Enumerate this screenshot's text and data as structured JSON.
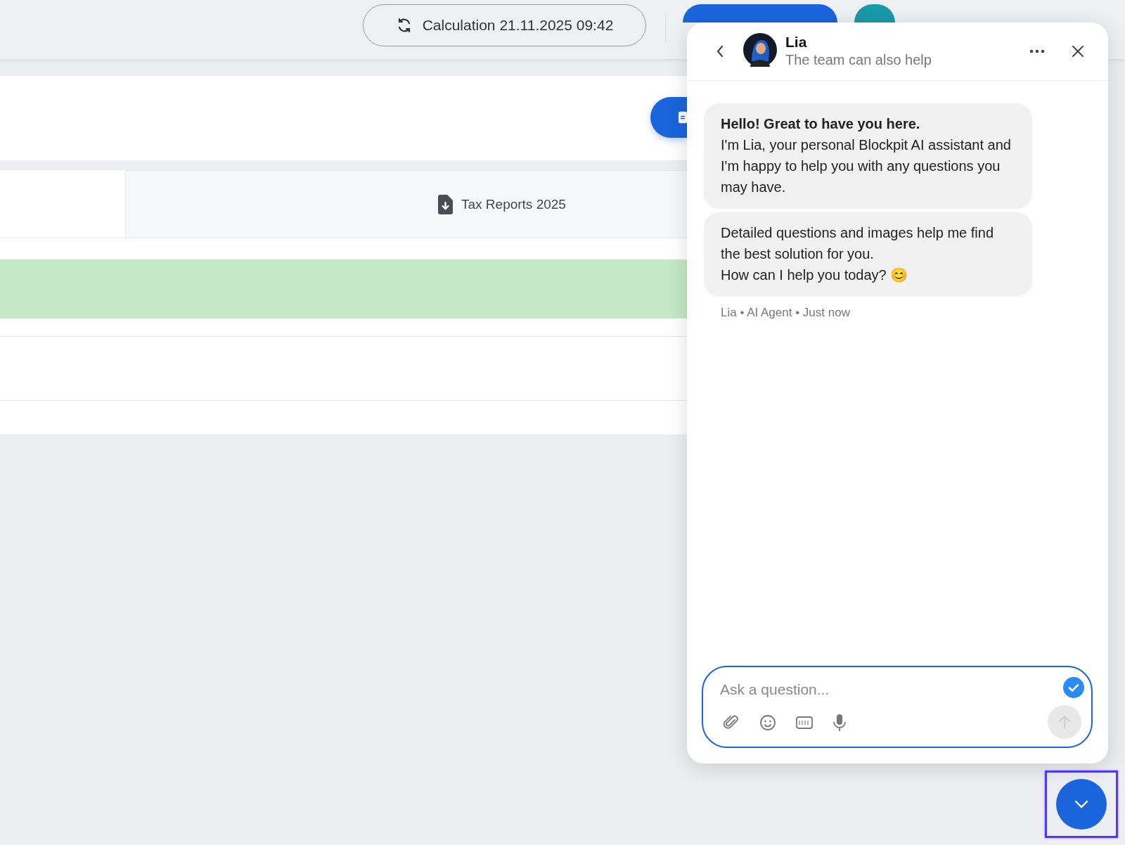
{
  "top_bar": {
    "calculation_button": "Calculation 21.11.2025 09:42"
  },
  "report_tab": {
    "label": "Tax Reports 2025"
  },
  "chat": {
    "agent_name": "Lia",
    "agent_subtitle": "The team can also help",
    "messages": [
      {
        "text": "**Hello! Great to have you here.**\nI'm Lia, your personal Blockpit AI assistant and I'm happy to help you with any questions you may have."
      },
      {
        "text": "Detailed questions and images help me find the best solution for you.\nHow can I help you today? 😊"
      }
    ],
    "meta": "Lia • AI Agent • Just now",
    "input": {
      "placeholder": "Ask a question...",
      "focused": true
    },
    "send": {
      "disabled": true
    }
  }
}
